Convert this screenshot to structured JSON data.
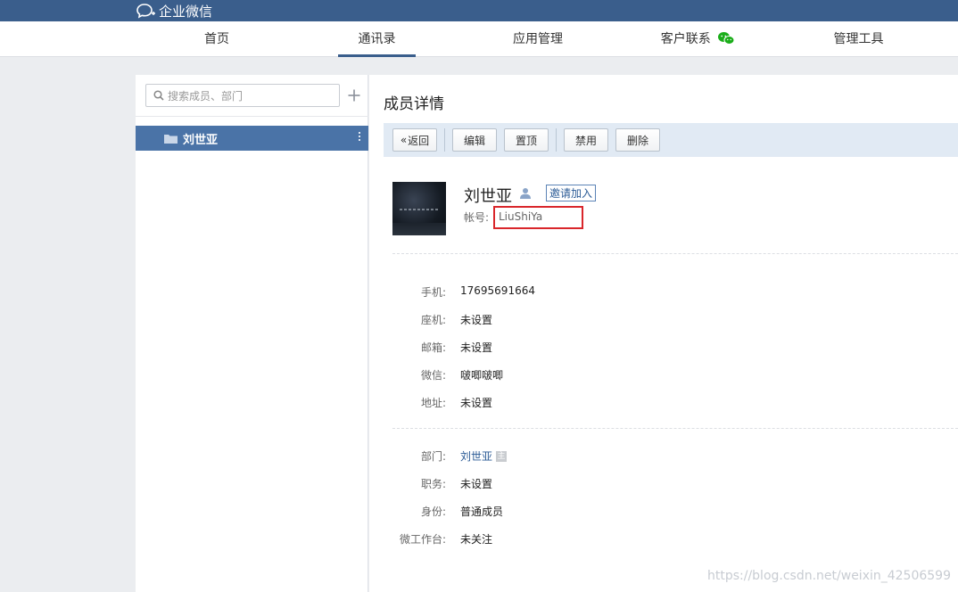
{
  "brand": {
    "name": "企业微信"
  },
  "nav": {
    "items": [
      {
        "label": "首页",
        "active": false
      },
      {
        "label": "通讯录",
        "active": true
      },
      {
        "label": "应用管理",
        "active": false
      },
      {
        "label": "客户联系",
        "active": false,
        "icon": "wechat-icon"
      },
      {
        "label": "管理工具",
        "active": false
      }
    ]
  },
  "sidebar": {
    "search_placeholder": "搜索成员、部门",
    "departments": [
      {
        "label": "刘世亚",
        "selected": true
      }
    ]
  },
  "main": {
    "title": "成员详情",
    "toolbar": {
      "back": "返回",
      "edit": "编辑",
      "pin": "置顶",
      "disable": "禁用",
      "delete": "删除"
    },
    "member": {
      "name": "刘世亚",
      "invite": "邀请加入",
      "account_label": "帐号:",
      "account_value": "LiuShiYa"
    },
    "contact_fields": [
      {
        "label": "手机:",
        "value": "17695691664"
      },
      {
        "label": "座机:",
        "value": "未设置"
      },
      {
        "label": "邮箱:",
        "value": "未设置"
      },
      {
        "label": "微信:",
        "value": "啵唧啵唧"
      },
      {
        "label": "地址:",
        "value": "未设置"
      }
    ],
    "org_fields": [
      {
        "label": "部门:",
        "value": "刘世亚",
        "tag": "主"
      },
      {
        "label": "职务:",
        "value": "未设置"
      },
      {
        "label": "身份:",
        "value": "普通成员"
      },
      {
        "label": "微工作台:",
        "value": "未关注"
      }
    ]
  },
  "watermark": "https://blog.csdn.net/weixin_42506599",
  "colors": {
    "topbar": "#3a5e8c",
    "selected_row": "#4a73a7",
    "toolbar_bg": "#e1eaf4",
    "highlight_box": "#d9262b",
    "wechat_green": "#1aad19"
  }
}
